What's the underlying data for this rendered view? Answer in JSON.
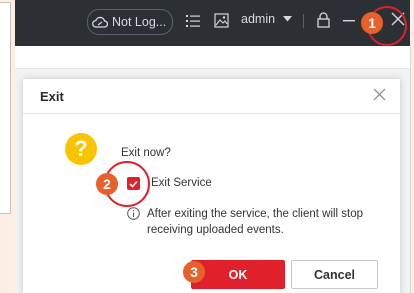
{
  "titlebar": {
    "account_status": "Not Log...",
    "username": "admin",
    "icons": [
      "cloud-icon",
      "list-icon",
      "image-icon",
      "chevron-down-icon",
      "lock-icon",
      "minimize-icon",
      "close-icon"
    ]
  },
  "dialog": {
    "title": "Exit",
    "question": "Exit now?",
    "checkbox_label": "Exit Service",
    "checkbox_checked": true,
    "info_text": "After exiting the service, the client will stop receiving uploaded events.",
    "ok_label": "OK",
    "cancel_label": "Cancel"
  },
  "annotations": {
    "step1": "1",
    "step2": "2",
    "step3": "3"
  },
  "colors": {
    "accent": "#e0202a",
    "badge": "#e8612b",
    "titlebar_bg": "#2c3035",
    "question_icon": "#f8c400"
  }
}
